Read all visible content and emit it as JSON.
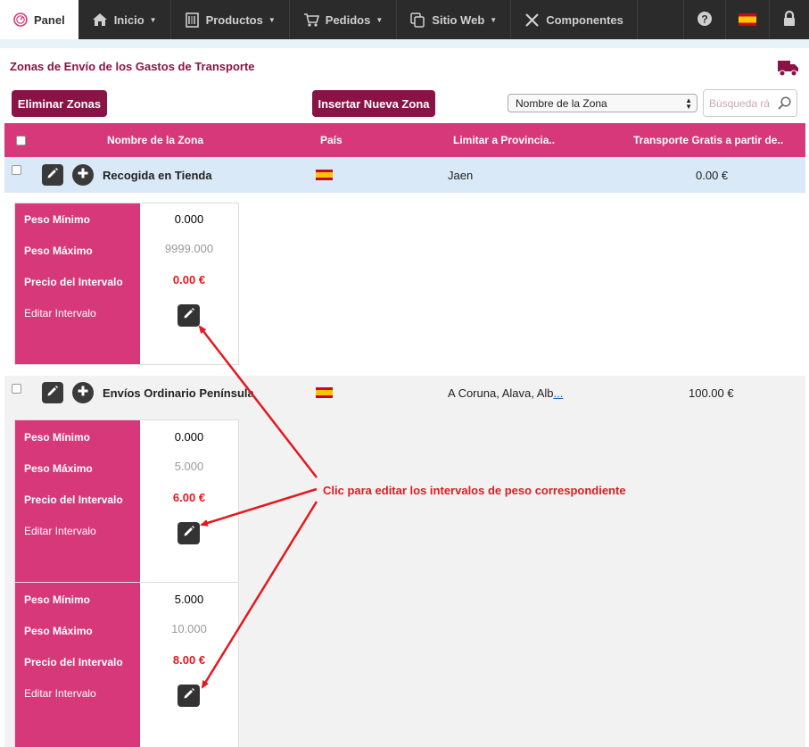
{
  "nav": {
    "panel": "Panel",
    "inicio": "Inicio",
    "productos": "Productos",
    "pedidos": "Pedidos",
    "sitio_web": "Sitio Web",
    "componentes": "Componentes"
  },
  "page": {
    "title": "Zonas de Envío de los Gastos de Transporte"
  },
  "toolbar": {
    "delete_label": "Eliminar Zonas",
    "insert_label": "Insertar Nueva Zona",
    "select_value": "Nombre de la Zona",
    "search_placeholder": "Búsqueda rá"
  },
  "table": {
    "headers": [
      "Nombre de la Zona",
      "País",
      "Limitar a Provincia..",
      "Transporte Gratis a partir de.."
    ],
    "rows": [
      {
        "name": "Recogida en Tienda",
        "provinces": "Jaen",
        "free_from": "0.00 €",
        "intervals": [
          {
            "min": "0.000",
            "max": "9999.000",
            "price": "0.00 €"
          }
        ]
      },
      {
        "name": "Envíos Ordinario Península",
        "provinces": "A Coruna, Alava, Alb",
        "provinces_more": "...",
        "free_from": "100.00 €",
        "intervals": [
          {
            "min": "0.000",
            "max": "5.000",
            "price": "6.00 €"
          },
          {
            "min": "5.000",
            "max": "10.000",
            "price": "8.00 €"
          }
        ]
      }
    ]
  },
  "interval_labels": {
    "min": "Peso Mínimo",
    "max": "Peso Máximo",
    "price": "Precio del Intervalo",
    "edit": "Editar Intervalo"
  },
  "annotation": "Clic para editar los intervalos de peso correspondiente",
  "colors": {
    "accent": "#d6387a",
    "brand": "#8a1346",
    "annotation": "#e3191e",
    "nav_bg": "#2b2b2b"
  },
  "icons": [
    "gauge-icon",
    "home-icon",
    "products-icon",
    "cart-icon",
    "copy-icon",
    "tools-icon",
    "help-icon",
    "spain-flag-icon",
    "lock-icon",
    "truck-icon",
    "search-icon",
    "pencil-icon",
    "plus-icon"
  ]
}
